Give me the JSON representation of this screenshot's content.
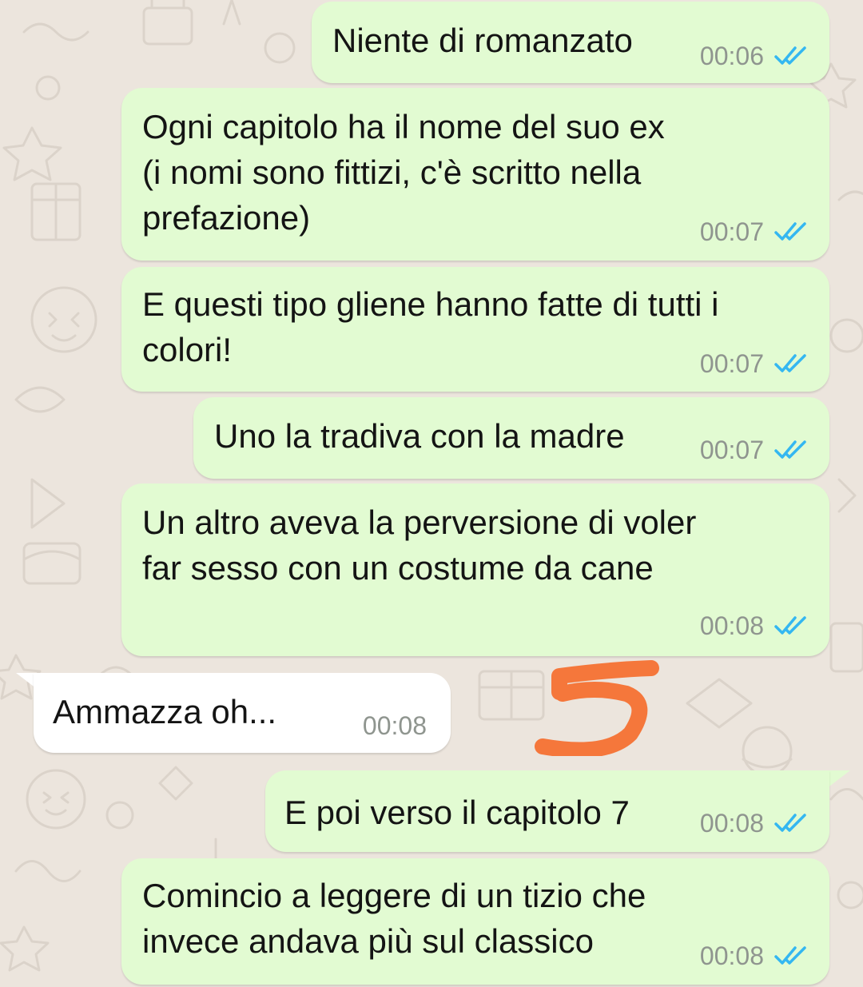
{
  "colors": {
    "outgoing_bubble": "#e2fbd2",
    "incoming_bubble": "#ffffff",
    "read_ticks": "#34b7f1",
    "timestamp": "#8f958f",
    "annotation": "#f5773b",
    "wallpaper": "#ece5dd"
  },
  "messages": [
    {
      "direction": "outgoing",
      "text": "Niente di romanzato",
      "time": "00:06",
      "status": "read",
      "status_icon": "double-check-icon"
    },
    {
      "direction": "outgoing",
      "text": "Ogni capitolo ha il nome del suo ex\n(i nomi sono fittizi, c'è scritto nella\nprefazione)",
      "time": "00:07",
      "status": "read",
      "status_icon": "double-check-icon"
    },
    {
      "direction": "outgoing",
      "text": "E questi tipo gliene hanno fatte di tutti i\ncolori!",
      "time": "00:07",
      "status": "read",
      "status_icon": "double-check-icon"
    },
    {
      "direction": "outgoing",
      "text": "Uno la tradiva con la madre",
      "time": "00:07",
      "status": "read",
      "status_icon": "double-check-icon"
    },
    {
      "direction": "outgoing",
      "text": "Un altro aveva la perversione di voler\nfar sesso con un costume da cane",
      "time": "00:08",
      "status": "read",
      "status_icon": "double-check-icon"
    },
    {
      "direction": "incoming",
      "text": "Ammazza oh...",
      "time": "00:08"
    },
    {
      "direction": "outgoing",
      "text": "E poi verso il capitolo 7",
      "time": "00:08",
      "status": "read",
      "status_icon": "double-check-icon"
    },
    {
      "direction": "outgoing",
      "text": "Comincio a leggere di un tizio che\ninvece andava più sul classico",
      "time": "00:08",
      "status": "read",
      "status_icon": "double-check-icon"
    }
  ],
  "annotation": {
    "icon": "handwritten-number-icon",
    "label": "5"
  }
}
